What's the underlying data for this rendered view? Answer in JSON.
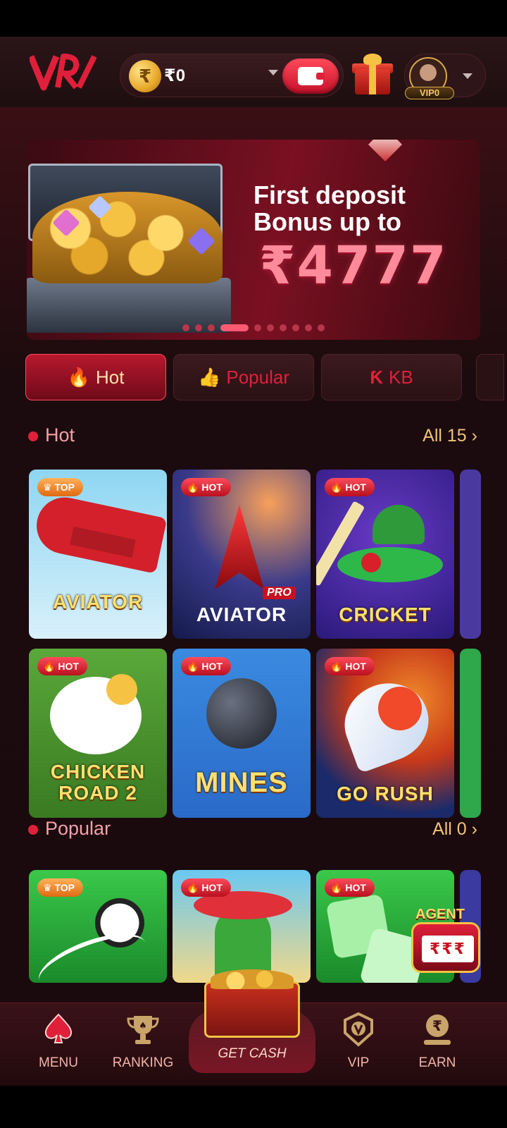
{
  "header": {
    "logo_text": "VR",
    "currency_symbol": "₹",
    "balance": "₹0",
    "vip_label": "VIP0"
  },
  "banner": {
    "line1": "First deposit",
    "line2": "Bonus up to",
    "amount": "₹4777",
    "slides_count": 10,
    "active_slide": 4
  },
  "tabs": [
    {
      "label": "Hot",
      "icon": "flame-icon"
    },
    {
      "label": "Popular",
      "icon": "thumbs-up-icon"
    },
    {
      "label": "KB",
      "icon": "kb-logo-icon"
    }
  ],
  "sections": {
    "hot": {
      "title": "Hot",
      "all": "All 15"
    },
    "popular": {
      "title": "Popular",
      "all": "All 0"
    }
  },
  "hot_games": [
    {
      "name": "AVIATOR",
      "badge": "TOP",
      "sub": ""
    },
    {
      "name": "AVIATOR",
      "badge": "HOT",
      "sub": "PRO"
    },
    {
      "name": "CRICKET",
      "badge": "HOT",
      "sub": ""
    },
    {
      "name": "CHICKEN ROAD 2",
      "badge": "HOT",
      "sub": ""
    },
    {
      "name": "MINES",
      "badge": "HOT",
      "sub": ""
    },
    {
      "name": "GO RUSH",
      "badge": "HOT",
      "sub": ""
    }
  ],
  "popular_games": [
    {
      "badge": "TOP"
    },
    {
      "badge": "HOT"
    },
    {
      "badge": "HOT"
    }
  ],
  "agent": {
    "title": "AGENT",
    "reels": "₹₹₹"
  },
  "nav": {
    "menu": "MENU",
    "ranking": "RANKING",
    "get_cash": "GET CASH",
    "vip": "VIP",
    "earn": "EARN"
  },
  "colors": {
    "accent": "#e0203a",
    "gold": "#f0c27a",
    "background": "#1a0a0d"
  }
}
